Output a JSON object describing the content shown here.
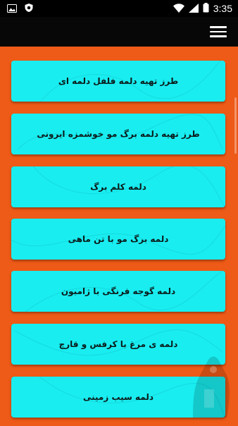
{
  "status_bar": {
    "time": "3:35",
    "left_icons": [
      "image-icon",
      "shield-icon"
    ],
    "right_icons": [
      "wifi-icon",
      "signal-icon",
      "battery-icon"
    ]
  },
  "app_bar": {
    "menu_icon": "hamburger-menu-icon"
  },
  "colors": {
    "background": "#ee5a17",
    "card": "#19edf0",
    "app_bar": "#070707",
    "status_bar": "#000000"
  },
  "items": [
    {
      "label": "طرز تهیه دلمه فلفل دلمه ای"
    },
    {
      "label": "طرز تهیه دلمه برگ مو خوشمزه ایرونی"
    },
    {
      "label": "دلمه کلم برگ"
    },
    {
      "label": "دلمه برگ مو با تن ماهی"
    },
    {
      "label": "دلمه گوجه فرنگی با ژامبون"
    },
    {
      "label": "دلمه ی مرغ با کرفس و قارچ"
    },
    {
      "label": "دلمه سیب زمینی"
    }
  ]
}
